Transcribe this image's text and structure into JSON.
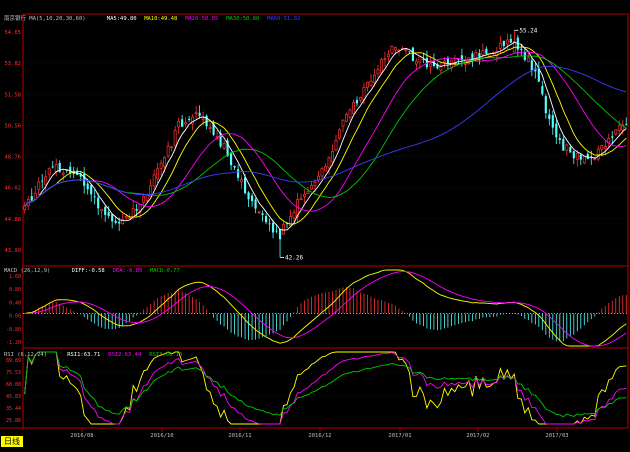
{
  "colors": {
    "background": "#000000",
    "up": "#ff3232",
    "down": "#54ffff",
    "axis": "#b40000",
    "grid": "#7a0000",
    "ma5": "#ffffff",
    "ma10": "#ffff00",
    "ma20": "#ff00ff",
    "ma30": "#00c800",
    "ma60": "#3c3cff",
    "label": "#c0c0c0",
    "extreme": "#ffffff",
    "period_bg": "#ffff00",
    "period_fg": "#000000"
  },
  "period_button": "日线",
  "chart_data": [
    {
      "type": "candlestick",
      "panel": "price",
      "header": {
        "name": "南京银行",
        "indicator": "MA(5,10,20,30,60)",
        "ma_legend": [
          {
            "label": "MA5:",
            "value": "49.80",
            "color_key": "ma5"
          },
          {
            "label": "MA10:",
            "value": "49.48",
            "color_key": "ma10"
          },
          {
            "label": "MA20:",
            "value": "50.05",
            "color_key": "ma20"
          },
          {
            "label": "MA30:",
            "value": "50.80",
            "color_key": "ma30"
          },
          {
            "label": "MA60:",
            "value": "51.02",
            "color_key": "ma60"
          }
        ]
      },
      "y_ticks": [
        "54.65",
        "53.82",
        "51.58",
        "50.56",
        "48.76",
        "46.02",
        "44.88",
        "43.90"
      ],
      "high_label": "55.24",
      "low_label": "42.26",
      "x_tick_labels": [
        "2016/08",
        "2016/10",
        "2016/11",
        "2016/12",
        "2017/01",
        "2017/02",
        "2017/03"
      ],
      "waypoints": [
        [
          0,
          45.2
        ],
        [
          8,
          47.5
        ],
        [
          15,
          47.0
        ],
        [
          22,
          44.8
        ],
        [
          28,
          44.2
        ],
        [
          34,
          45.6
        ],
        [
          40,
          47.9
        ],
        [
          44,
          49.8
        ],
        [
          50,
          50.5
        ],
        [
          57,
          48.6
        ],
        [
          63,
          46.0
        ],
        [
          69,
          44.3
        ],
        [
          73,
          43.6
        ],
        [
          79,
          45.7
        ],
        [
          85,
          47.2
        ],
        [
          90,
          49.5
        ],
        [
          95,
          51.3
        ],
        [
          100,
          52.8
        ],
        [
          106,
          54.4
        ],
        [
          112,
          53.6
        ],
        [
          118,
          53.2
        ],
        [
          124,
          53.5
        ],
        [
          130,
          53.8
        ],
        [
          136,
          54.3
        ],
        [
          140,
          54.7
        ],
        [
          143,
          53.8
        ],
        [
          147,
          52.3
        ],
        [
          150,
          50.0
        ],
        [
          154,
          48.6
        ],
        [
          158,
          48.0
        ],
        [
          162,
          47.8
        ],
        [
          167,
          49.1
        ],
        [
          172,
          49.9
        ]
      ]
    },
    {
      "type": "line",
      "panel": "macd",
      "header": {
        "name": "MACD (26,12,9)",
        "legend": [
          {
            "label": "DIFF:",
            "value": "-0.58",
            "color_key": "ma5"
          },
          {
            "label": "DEA:",
            "value": "-0.85",
            "color_key": "ma20"
          },
          {
            "label": "MACD:",
            "value": "0.77",
            "color_key": "ma30"
          }
        ]
      },
      "y_ticks": [
        "1.60",
        "0.80",
        "0.40",
        "0.00",
        "-0.80",
        "-1.20"
      ],
      "ylim": [
        -1.3,
        1.75
      ]
    },
    {
      "type": "line",
      "panel": "rsi",
      "header": {
        "name": "RSI (6,12,24)",
        "legend": [
          {
            "label": "RSI1:",
            "value": "63.71",
            "color_key": "ma5"
          },
          {
            "label": "RSI2:",
            "value": "63.44",
            "color_key": "ma20"
          },
          {
            "label": "RSI3:",
            "value": "60.13",
            "color_key": "ma30"
          }
        ]
      },
      "y_ticks": [
        "89.89",
        "75.53",
        "60.00",
        "45.83",
        "35.44",
        "25.86"
      ],
      "ylim": [
        18,
        95
      ]
    }
  ]
}
